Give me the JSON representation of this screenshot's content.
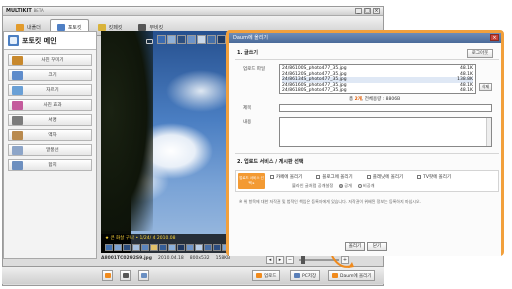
{
  "app": {
    "title": "MULTIKIT",
    "subtitle": "BETA",
    "window_buttons": [
      "_",
      "□",
      "×"
    ]
  },
  "main_tabs": [
    {
      "label": "내폴더",
      "icon": "folder-icon",
      "color": "#e29b2c"
    },
    {
      "label": "포토킷",
      "icon": "photo-icon",
      "color": "#4f7fc4"
    },
    {
      "label": "킷페킷",
      "icon": "kit-icon",
      "color": "#d9b33a"
    },
    {
      "label": "무비킷",
      "icon": "movie-icon",
      "color": "#555555"
    }
  ],
  "sidebar": {
    "title": "포토킷 메인",
    "items": [
      {
        "label": "사진 꾸미기",
        "icon": "pencil-icon",
        "color": "#c8892e"
      },
      {
        "label": "크기",
        "icon": "resize-icon",
        "color": "#5f8ccb"
      },
      {
        "label": "자르기",
        "icon": "crop-icon",
        "color": "#6aa0d6"
      },
      {
        "label": "사진 효과",
        "icon": "effect-icon",
        "color": "#c45b9c"
      },
      {
        "label": "서명",
        "icon": "signature-icon",
        "color": "#7c7c7c"
      },
      {
        "label": "액자",
        "icon": "frame-icon",
        "color": "#b98a4e"
      },
      {
        "label": "말풍선",
        "icon": "speech-bubble-icon",
        "color": "#8da5c8"
      },
      {
        "label": "합치",
        "icon": "merge-icon",
        "color": "#6d8fbf"
      }
    ]
  },
  "viewer": {
    "caption": "★ 큰 화살 구나 • 1/24/ 4 2010.08"
  },
  "status": {
    "filename": "A8001TC0292S9.jpg",
    "date": "2010.04.18",
    "dims": "800x532",
    "size": "158KB"
  },
  "bottom_toolbar": {
    "upload_label": "업로드",
    "print_label": "PC저장",
    "daum_label": "Daum에 올리기"
  },
  "dialog": {
    "title": "Daum에 올리기",
    "close": "×",
    "section1": "1. 글쓰기",
    "login_button": "로그아웃",
    "file_label": "업로드 파일",
    "files": [
      {
        "name": "24/86100S_photo477_35.jpg",
        "size": "48.1K"
      },
      {
        "name": "24/86120S_photo477_35.jpg",
        "size": "48.1K"
      },
      {
        "name": "24/86134S_photo477_35.jpg",
        "size": "138.8K"
      },
      {
        "name": "24/86160S_photo477_35.jpg",
        "size": "48.1K"
      },
      {
        "name": "24/86180S_photo477_35.jpg",
        "size": "48.1K"
      }
    ],
    "delete_button": "삭제",
    "file_summary_prefix": "총 ",
    "file_summary_count": "2개",
    "file_summary_suffix": ", 전체용량 : 8806B",
    "title_label": "제목",
    "content_label": "내용",
    "section2": "2. 업로드 서비스 / 게시판 선택",
    "service_tag": "업로드 서비스 선택 ▸",
    "services": [
      "카페에 올리기",
      "블로그에 올리기",
      "플래닛에 올리기",
      "TV팟에 올리기"
    ],
    "visibility_label": "블라인 글처럼 공개설정",
    "visibility_options": [
      "공개",
      "비공개"
    ],
    "notice": "※ 위 항목에 대한 저작권 및 법적인 책임은 등록자에게 있습니다. 저작권이 위배된 정보는 등록하지 마십시오.",
    "ok_button": "올리기",
    "cancel_button": "닫기"
  }
}
